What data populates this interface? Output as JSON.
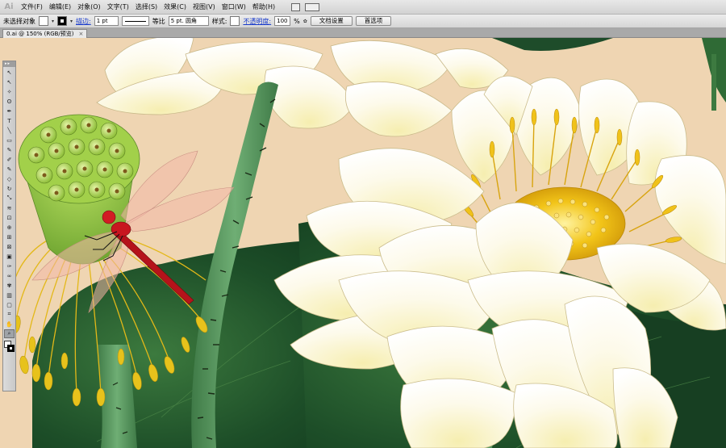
{
  "menubar": {
    "logo": "Ai",
    "items": [
      "文件(F)",
      "编辑(E)",
      "对象(O)",
      "文字(T)",
      "选择(S)",
      "效果(C)",
      "视图(V)",
      "窗口(W)",
      "帮助(H)"
    ]
  },
  "controlbar": {
    "selection_status": "未选择对象",
    "stroke_link": "描边:",
    "stroke_weight": "1 pt",
    "profile": "等比",
    "brush": "5 pt. 圆角",
    "style_label": "样式:",
    "opacity_link": "不透明度:",
    "opacity_value": "100",
    "percent": "%",
    "doc_setup_button": "文档设置",
    "preferences_button": "首选项"
  },
  "document": {
    "tab_title": "0.ai @ 150% (RGB/预览)",
    "close": "×"
  },
  "tools": {
    "header": "▸▸",
    "icons": [
      "selection-tool",
      "direct-selection-tool",
      "magic-wand-tool",
      "lasso-tool",
      "pen-tool",
      "type-tool",
      "line-segment-tool",
      "rectangle-tool",
      "paintbrush-tool",
      "pencil-tool",
      "blob-brush-tool",
      "eraser-tool",
      "rotate-tool",
      "scale-tool",
      "warp-tool",
      "free-transform-tool",
      "shape-builder-tool",
      "perspective-grid-tool",
      "mesh-tool",
      "gradient-tool",
      "eyedropper-tool",
      "blend-tool",
      "symbol-sprayer-tool",
      "column-graph-tool",
      "artboard-tool",
      "slice-tool",
      "hand-tool",
      "zoom-tool"
    ],
    "glyphs": [
      "↖",
      "↖",
      "✧",
      "ʘ",
      "✒",
      "T",
      "╲",
      "▭",
      "✎",
      "✐",
      "✎",
      "◇",
      "↻",
      "⤡",
      "≋",
      "⊡",
      "⊕",
      "⊞",
      "⊠",
      "▣",
      "✑",
      "∞",
      "✾",
      "▥",
      "▢",
      "⌗",
      "✋",
      "⌕"
    ]
  },
  "colors": {
    "canvas_bg": "#efd5b2",
    "leaf_dark": "#1f4a2a",
    "stem_green": "#5e9b66",
    "pod_green": "#9ccd4a",
    "petal_white": "#fdfbee",
    "stamen_yellow": "#f0c21a",
    "dragonfly_red": "#c0141c"
  }
}
